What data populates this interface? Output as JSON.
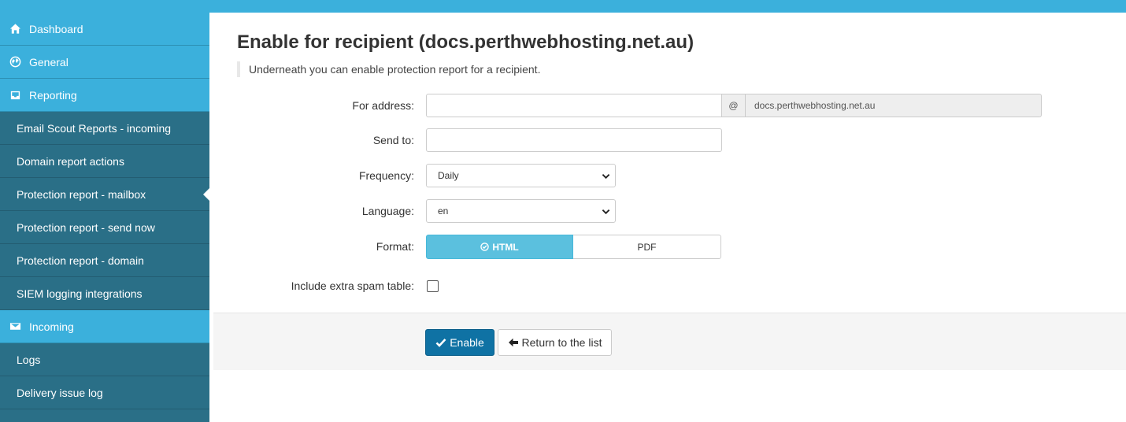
{
  "sidebar": {
    "sections": [
      {
        "label": "Dashboard",
        "icon": "home-icon"
      },
      {
        "label": "General",
        "icon": "globe-icon"
      },
      {
        "label": "Reporting",
        "icon": "inbox-icon"
      },
      {
        "label": "Incoming",
        "icon": "envelope-icon"
      }
    ],
    "reporting_items": [
      {
        "label": "Email Scout Reports - incoming"
      },
      {
        "label": "Domain report actions"
      },
      {
        "label": "Protection report - mailbox",
        "active": true
      },
      {
        "label": "Protection report - send now"
      },
      {
        "label": "Protection report - domain"
      },
      {
        "label": "SIEM logging integrations"
      }
    ],
    "incoming_items": [
      {
        "label": "Logs"
      },
      {
        "label": "Delivery issue log"
      }
    ]
  },
  "page": {
    "title": "Enable for recipient (docs.perthwebhosting.net.au)",
    "intro": "Underneath you can enable protection report for a recipient."
  },
  "form": {
    "for_address_label": "For address:",
    "for_address_value": "",
    "at_symbol": "@",
    "domain": "docs.perthwebhosting.net.au",
    "send_to_label": "Send to:",
    "send_to_value": "",
    "frequency_label": "Frequency:",
    "frequency_value": "Daily",
    "language_label": "Language:",
    "language_value": "en",
    "format_label": "Format:",
    "format_options": [
      "HTML",
      "PDF"
    ],
    "format_selected": "HTML",
    "extra_spam_label": "Include extra spam table:",
    "extra_spam_checked": false
  },
  "actions": {
    "enable_label": "Enable",
    "return_label": "Return to the list"
  },
  "colors": {
    "topbar": "#3bb0dc",
    "sidebar_section": "#3bb0dc",
    "sidebar_item": "#2a6f87",
    "primary_button": "#0f72a4",
    "format_selected": "#5bc0de"
  }
}
